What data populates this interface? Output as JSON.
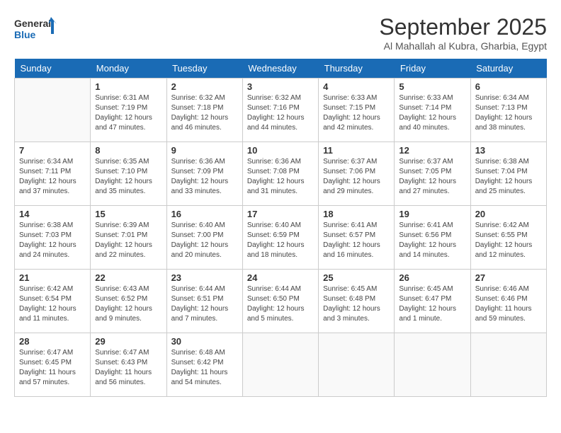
{
  "logo": {
    "line1": "General",
    "line2": "Blue"
  },
  "title": "September 2025",
  "location": "Al Mahallah al Kubra, Gharbia, Egypt",
  "weekdays": [
    "Sunday",
    "Monday",
    "Tuesday",
    "Wednesday",
    "Thursday",
    "Friday",
    "Saturday"
  ],
  "weeks": [
    [
      {
        "day": null,
        "info": null
      },
      {
        "day": "1",
        "info": "Sunrise: 6:31 AM\nSunset: 7:19 PM\nDaylight: 12 hours\nand 47 minutes."
      },
      {
        "day": "2",
        "info": "Sunrise: 6:32 AM\nSunset: 7:18 PM\nDaylight: 12 hours\nand 46 minutes."
      },
      {
        "day": "3",
        "info": "Sunrise: 6:32 AM\nSunset: 7:16 PM\nDaylight: 12 hours\nand 44 minutes."
      },
      {
        "day": "4",
        "info": "Sunrise: 6:33 AM\nSunset: 7:15 PM\nDaylight: 12 hours\nand 42 minutes."
      },
      {
        "day": "5",
        "info": "Sunrise: 6:33 AM\nSunset: 7:14 PM\nDaylight: 12 hours\nand 40 minutes."
      },
      {
        "day": "6",
        "info": "Sunrise: 6:34 AM\nSunset: 7:13 PM\nDaylight: 12 hours\nand 38 minutes."
      }
    ],
    [
      {
        "day": "7",
        "info": "Sunrise: 6:34 AM\nSunset: 7:11 PM\nDaylight: 12 hours\nand 37 minutes."
      },
      {
        "day": "8",
        "info": "Sunrise: 6:35 AM\nSunset: 7:10 PM\nDaylight: 12 hours\nand 35 minutes."
      },
      {
        "day": "9",
        "info": "Sunrise: 6:36 AM\nSunset: 7:09 PM\nDaylight: 12 hours\nand 33 minutes."
      },
      {
        "day": "10",
        "info": "Sunrise: 6:36 AM\nSunset: 7:08 PM\nDaylight: 12 hours\nand 31 minutes."
      },
      {
        "day": "11",
        "info": "Sunrise: 6:37 AM\nSunset: 7:06 PM\nDaylight: 12 hours\nand 29 minutes."
      },
      {
        "day": "12",
        "info": "Sunrise: 6:37 AM\nSunset: 7:05 PM\nDaylight: 12 hours\nand 27 minutes."
      },
      {
        "day": "13",
        "info": "Sunrise: 6:38 AM\nSunset: 7:04 PM\nDaylight: 12 hours\nand 25 minutes."
      }
    ],
    [
      {
        "day": "14",
        "info": "Sunrise: 6:38 AM\nSunset: 7:03 PM\nDaylight: 12 hours\nand 24 minutes."
      },
      {
        "day": "15",
        "info": "Sunrise: 6:39 AM\nSunset: 7:01 PM\nDaylight: 12 hours\nand 22 minutes."
      },
      {
        "day": "16",
        "info": "Sunrise: 6:40 AM\nSunset: 7:00 PM\nDaylight: 12 hours\nand 20 minutes."
      },
      {
        "day": "17",
        "info": "Sunrise: 6:40 AM\nSunset: 6:59 PM\nDaylight: 12 hours\nand 18 minutes."
      },
      {
        "day": "18",
        "info": "Sunrise: 6:41 AM\nSunset: 6:57 PM\nDaylight: 12 hours\nand 16 minutes."
      },
      {
        "day": "19",
        "info": "Sunrise: 6:41 AM\nSunset: 6:56 PM\nDaylight: 12 hours\nand 14 minutes."
      },
      {
        "day": "20",
        "info": "Sunrise: 6:42 AM\nSunset: 6:55 PM\nDaylight: 12 hours\nand 12 minutes."
      }
    ],
    [
      {
        "day": "21",
        "info": "Sunrise: 6:42 AM\nSunset: 6:54 PM\nDaylight: 12 hours\nand 11 minutes."
      },
      {
        "day": "22",
        "info": "Sunrise: 6:43 AM\nSunset: 6:52 PM\nDaylight: 12 hours\nand 9 minutes."
      },
      {
        "day": "23",
        "info": "Sunrise: 6:44 AM\nSunset: 6:51 PM\nDaylight: 12 hours\nand 7 minutes."
      },
      {
        "day": "24",
        "info": "Sunrise: 6:44 AM\nSunset: 6:50 PM\nDaylight: 12 hours\nand 5 minutes."
      },
      {
        "day": "25",
        "info": "Sunrise: 6:45 AM\nSunset: 6:48 PM\nDaylight: 12 hours\nand 3 minutes."
      },
      {
        "day": "26",
        "info": "Sunrise: 6:45 AM\nSunset: 6:47 PM\nDaylight: 12 hours\nand 1 minute."
      },
      {
        "day": "27",
        "info": "Sunrise: 6:46 AM\nSunset: 6:46 PM\nDaylight: 11 hours\nand 59 minutes."
      }
    ],
    [
      {
        "day": "28",
        "info": "Sunrise: 6:47 AM\nSunset: 6:45 PM\nDaylight: 11 hours\nand 57 minutes."
      },
      {
        "day": "29",
        "info": "Sunrise: 6:47 AM\nSunset: 6:43 PM\nDaylight: 11 hours\nand 56 minutes."
      },
      {
        "day": "30",
        "info": "Sunrise: 6:48 AM\nSunset: 6:42 PM\nDaylight: 11 hours\nand 54 minutes."
      },
      {
        "day": null,
        "info": null
      },
      {
        "day": null,
        "info": null
      },
      {
        "day": null,
        "info": null
      },
      {
        "day": null,
        "info": null
      }
    ]
  ]
}
